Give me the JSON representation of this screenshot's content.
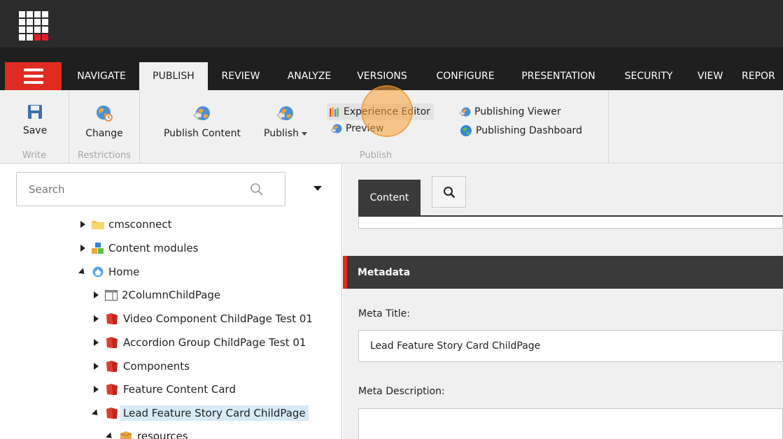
{
  "nav": {
    "tabs": [
      {
        "label": "NAVIGATE"
      },
      {
        "label": "PUBLISH"
      },
      {
        "label": "REVIEW"
      },
      {
        "label": "ANALYZE"
      },
      {
        "label": "VERSIONS"
      },
      {
        "label": "CONFIGURE"
      },
      {
        "label": "PRESENTATION"
      },
      {
        "label": "SECURITY"
      },
      {
        "label": "VIEW"
      },
      {
        "label": "REPOR"
      }
    ],
    "active_tab": "PUBLISH"
  },
  "ribbon": {
    "write": {
      "label": "Write",
      "save": "Save"
    },
    "restrictions": {
      "label": "Restrictions",
      "change": "Change"
    },
    "publish": {
      "label": "Publish",
      "publish_content": "Publish Content",
      "publish": "Publish",
      "experience_editor": "Experience Editor",
      "preview": "Preview",
      "publishing_viewer": "Publishing Viewer",
      "publishing_dashboard": "Publishing Dashboard"
    }
  },
  "tree": {
    "search_placeholder": "Search",
    "items": [
      {
        "label": "cmsconnect",
        "icon": "folder-icon",
        "expanded": false
      },
      {
        "label": "Content modules",
        "icon": "modules-icon",
        "expanded": false
      },
      {
        "label": "Home",
        "icon": "home-icon",
        "expanded": true
      },
      {
        "label": "2ColumnChildPage",
        "icon": "page-icon",
        "expanded": false
      },
      {
        "label": "Video Component ChildPage Test 01",
        "icon": "red-page-icon",
        "expanded": false
      },
      {
        "label": "Accordion Group ChildPage Test 01",
        "icon": "red-page-icon",
        "expanded": false
      },
      {
        "label": "Components",
        "icon": "red-page-icon",
        "expanded": false
      },
      {
        "label": "Feature Content Card",
        "icon": "red-page-icon",
        "expanded": false
      },
      {
        "label": "Lead Feature Story Card ChildPage",
        "icon": "red-page-icon",
        "expanded": true,
        "selected": true
      },
      {
        "label": "resources",
        "icon": "box-icon",
        "expanded": true
      }
    ]
  },
  "editor": {
    "content_tab": "Content",
    "section_title": "Metadata",
    "meta_title_label": "Meta Title:",
    "meta_title_value": "Lead Feature Story Card ChildPage",
    "meta_description_label": "Meta Description:",
    "meta_description_value": ""
  },
  "colors": {
    "accent_red": "#e02b20",
    "topbar": "#2b2b2b",
    "navbar": "#1f1f1f",
    "selection": "#d7eaf7"
  }
}
